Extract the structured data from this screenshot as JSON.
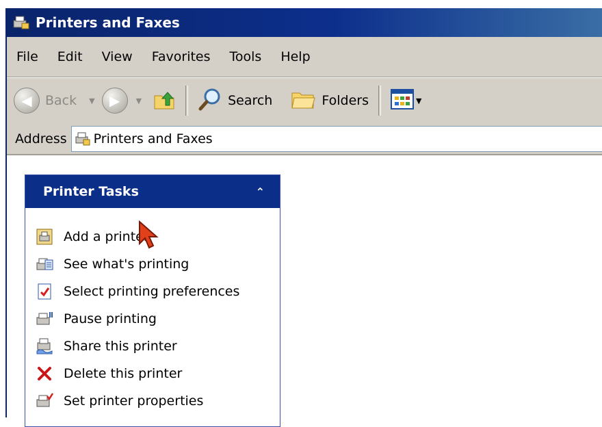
{
  "window": {
    "title": "Printers and Faxes"
  },
  "menu": [
    "File",
    "Edit",
    "View",
    "Favorites",
    "Tools",
    "Help"
  ],
  "toolbar": {
    "back_label": "Back",
    "search_label": "Search",
    "folders_label": "Folders"
  },
  "address": {
    "label": "Address",
    "value": "Printers and Faxes"
  },
  "tasks_panel": {
    "title": "Printer Tasks",
    "collapse_glyph": "⌃",
    "items": [
      {
        "label": "Add a printer",
        "icon": "add-printer-icon"
      },
      {
        "label": "See what's printing",
        "icon": "print-queue-icon"
      },
      {
        "label": "Select printing preferences",
        "icon": "printing-preferences-icon"
      },
      {
        "label": "Pause printing",
        "icon": "pause-printer-icon"
      },
      {
        "label": "Share this printer",
        "icon": "share-printer-icon"
      },
      {
        "label": "Delete this printer",
        "icon": "delete-icon"
      },
      {
        "label": "Set printer properties",
        "icon": "printer-properties-icon"
      }
    ]
  },
  "colors": {
    "title_bar": "#0a246a",
    "task_header": "#0b2f88",
    "chrome": "#d4d0c8"
  }
}
